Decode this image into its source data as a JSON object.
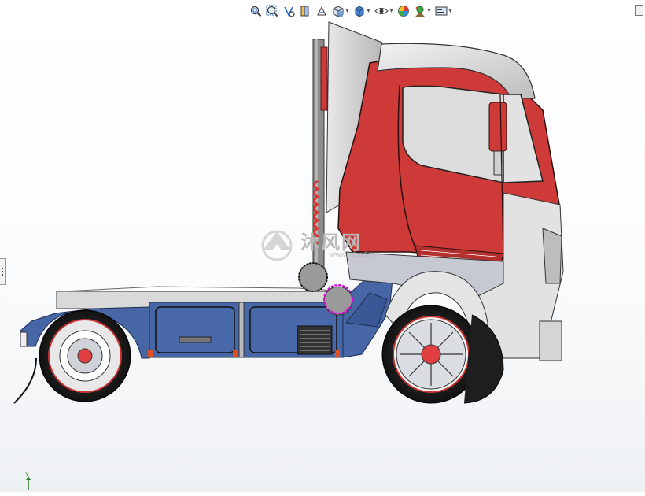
{
  "toolbar": {
    "buttons": [
      {
        "id": "zoom-to-fit",
        "icon": "zoom-to-fit-icon",
        "dropdown": false
      },
      {
        "id": "zoom-to-area",
        "icon": "zoom-to-area-icon",
        "dropdown": false
      },
      {
        "id": "previous-view",
        "icon": "previous-view-icon",
        "dropdown": false
      },
      {
        "id": "section-view",
        "icon": "section-view-icon",
        "dropdown": false
      },
      {
        "id": "dynamic-annotation",
        "icon": "dynamic-annotation-icon",
        "dropdown": false
      },
      {
        "id": "view-orientation",
        "icon": "view-orientation-icon",
        "dropdown": true
      },
      {
        "id": "display-style",
        "icon": "display-style-icon",
        "dropdown": true
      },
      {
        "id": "hide-show-items",
        "icon": "hide-show-items-icon",
        "dropdown": true
      },
      {
        "id": "edit-appearance",
        "icon": "edit-appearance-icon",
        "dropdown": false
      },
      {
        "id": "apply-scene",
        "icon": "apply-scene-icon",
        "dropdown": true
      },
      {
        "id": "view-settings",
        "icon": "view-settings-icon",
        "dropdown": true
      }
    ]
  },
  "model": {
    "cab_color": "#cd3a38",
    "chassis_color": "#4766a6",
    "roof_color": "#dcdcdc",
    "tire_color": "#1e1e1e",
    "rim_color": "#c9ccd1",
    "selection_color": "#e000e0"
  },
  "watermark": {
    "text": "沐风网",
    "url": "www.mfcad.com"
  },
  "triad": {
    "axis_label": "Y"
  }
}
